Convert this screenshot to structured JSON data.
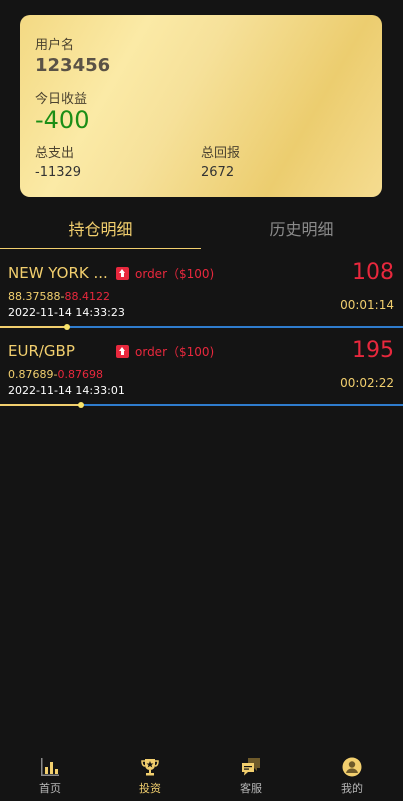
{
  "account": {
    "username_label": "用户名",
    "username": "123456",
    "today_label": "今日收益",
    "today_value": "-400",
    "expense_label": "总支出",
    "expense_value": "-11329",
    "return_label": "总回报",
    "return_value": "2672"
  },
  "tabs": {
    "active": "持仓明细",
    "inactive": "历史明细"
  },
  "positions": [
    {
      "name": "NEW YORK ...",
      "order": "order（$100)",
      "open_price": "88.37588",
      "current_price": "88.4122",
      "separator": "-",
      "time": "2022-11-14 14:33:23",
      "profit": "108",
      "duration": "00:01:14",
      "progress": 0.167
    },
    {
      "name": "EUR/GBP",
      "order": "order（$100)",
      "open_price": "0.87689",
      "current_price": "0.87698",
      "separator": "-",
      "time": "2022-11-14 14:33:01",
      "profit": "195",
      "duration": "00:02:22",
      "progress": 0.201
    }
  ],
  "nav": {
    "home": "首页",
    "invest": "投资",
    "service": "客服",
    "mine": "我的"
  },
  "colors": {
    "gold": "#f2cf6e",
    "red": "#e8283d",
    "green": "#1b8e16",
    "blue": "#2f7ccd",
    "background": "#141414"
  },
  "icons": [
    "bar-chart-icon",
    "trophy-icon",
    "chat-bubbles-icon",
    "user-avatar-icon",
    "arrow-up-icon"
  ]
}
